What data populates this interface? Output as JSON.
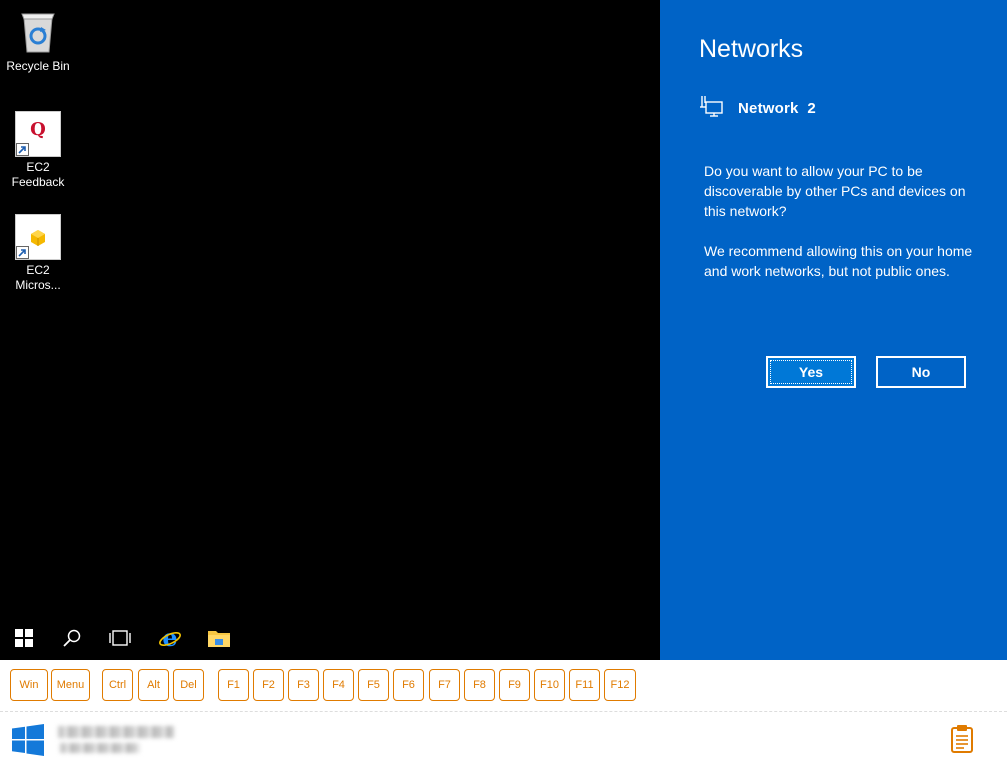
{
  "desktop": {
    "icons": [
      {
        "label": "Recycle Bin"
      },
      {
        "label": "EC2 Feedback",
        "glyph": "Q"
      },
      {
        "label": "EC2 Micros..."
      }
    ]
  },
  "flyout": {
    "title": "Networks",
    "network_name": "Network  2",
    "question": "Do you want to allow your PC to be discoverable by other PCs and devices on this network?",
    "recommendation": "We recommend allowing this on your home and work networks, but not public ones.",
    "yes_label": "Yes",
    "no_label": "No",
    "colors": {
      "background": "#0063c6",
      "button_focus": "#0078d7"
    }
  },
  "taskbar": {
    "items": [
      "start-icon",
      "search-icon",
      "task-view-icon",
      "internet-explorer-icon",
      "file-explorer-icon"
    ]
  },
  "keybar": {
    "keys": [
      "Win",
      "Menu",
      "Ctrl",
      "Alt",
      "Del",
      "F1",
      "F2",
      "F3",
      "F4",
      "F5",
      "F6",
      "F7",
      "F8",
      "F9",
      "F10",
      "F11",
      "F12"
    ],
    "accent": "#e07b00"
  },
  "footer": {
    "logo": "windows-logo-icon",
    "clipboard": "clipboard-icon"
  }
}
